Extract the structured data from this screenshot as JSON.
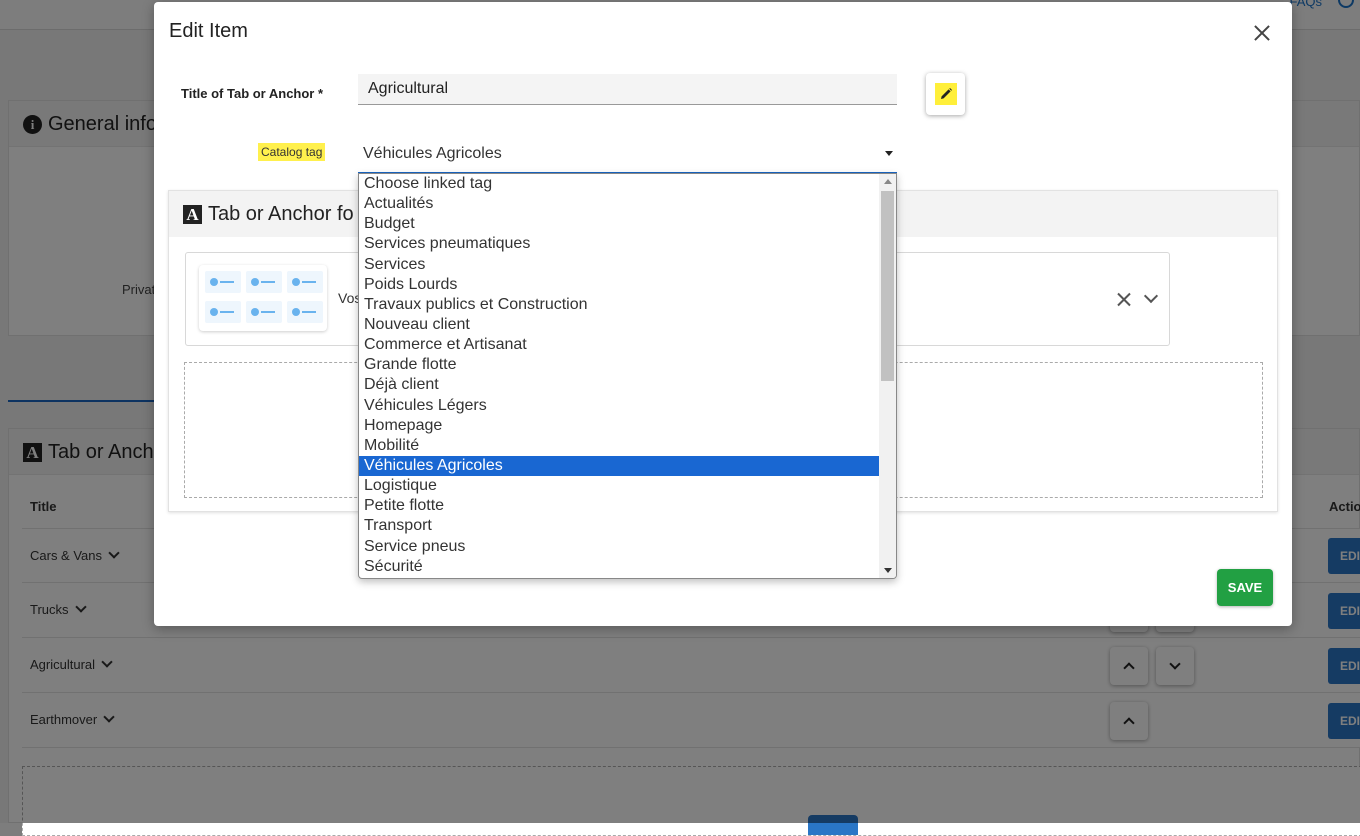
{
  "background": {
    "top_link": "FAQs",
    "general_card_title": "General info",
    "private_label": "Privat",
    "tabs_card_title": "Tab or Anch",
    "table": {
      "col_title": "Title",
      "col_actions": "Actio",
      "rows": [
        {
          "title": "Cars & Vans"
        },
        {
          "title": "Trucks"
        },
        {
          "title": "Agricultural"
        },
        {
          "title": "Earthmover"
        }
      ],
      "edit_label": "EDI"
    }
  },
  "modal": {
    "title": "Edit Item",
    "title_field_label": "Title of Tab or Anchor *",
    "title_field_value": "Agricultural",
    "catalog_tag_label": "Catalog tag",
    "catalog_tag_value": "Véhicules Agricoles",
    "form_card_title": "Tab or Anchor fo",
    "template_text": "Vos",
    "save_label": "SAVE"
  },
  "dropdown": {
    "options": [
      "Choose linked tag",
      "Actualités",
      "Budget",
      "Services pneumatiques",
      "Services",
      "Poids Lourds",
      "Travaux publics et Construction",
      "Nouveau client",
      "Commerce et Artisanat",
      "Grande flotte",
      "Déjà client",
      "Véhicules Légers",
      "Homepage",
      "Mobilité",
      "Véhicules Agricoles",
      "Logistique",
      "Petite flotte",
      "Transport",
      "Service pneus",
      "Sécurité"
    ],
    "selected": "Véhicules Agricoles"
  },
  "colors": {
    "save": "#22a043",
    "highlight": "#fff04d",
    "selected_option": "#1967d2",
    "edit_button": "#2a76c6"
  }
}
